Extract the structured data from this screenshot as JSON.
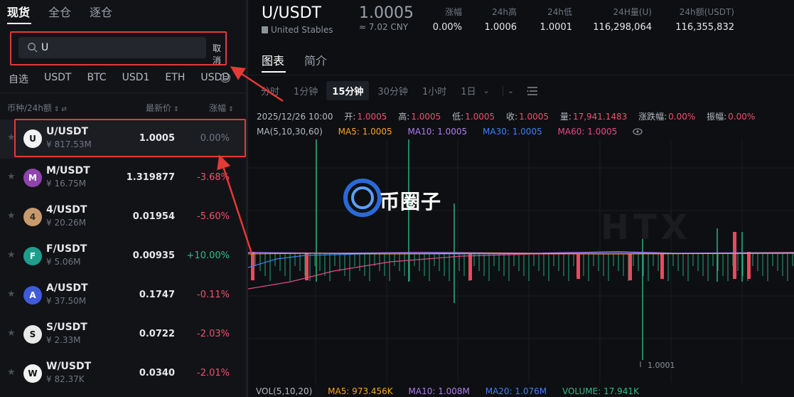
{
  "top_tabs": [
    {
      "label": "现货"
    },
    {
      "label": "全仓"
    },
    {
      "label": "逐仓"
    }
  ],
  "search": {
    "value": "U",
    "cancel_label": "取消"
  },
  "quote_tabs": [
    {
      "label": "自选"
    },
    {
      "label": "USDT"
    },
    {
      "label": "BTC"
    },
    {
      "label": "USD1"
    },
    {
      "label": "ETH"
    },
    {
      "label": "USDD"
    }
  ],
  "list_header": {
    "pair_col": "币种/24h额",
    "price_col": "最新价",
    "change_col": "涨幅"
  },
  "rows": [
    {
      "pair": "U/USDT",
      "vol": "¥ 817.53M",
      "price": "1.0005",
      "change": "0.00%",
      "dir": "neutral",
      "logo_bg": "#f2f2f2",
      "logo_fg": "#111111",
      "logo_char": "U"
    },
    {
      "pair": "M/USDT",
      "vol": "¥ 16.75M",
      "price": "1.319877",
      "change": "-3.68%",
      "dir": "down",
      "logo_bg": "#8e44ad",
      "logo_fg": "#ffffff",
      "logo_char": "M"
    },
    {
      "pair": "4/USDT",
      "vol": "¥ 20.26M",
      "price": "0.01954",
      "change": "-5.60%",
      "dir": "down",
      "logo_bg": "#c79a6e",
      "logo_fg": "#3a2a1e",
      "logo_char": "4"
    },
    {
      "pair": "F/USDT",
      "vol": "¥ 5.06M",
      "price": "0.00935",
      "change": "+10.00%",
      "dir": "up",
      "logo_bg": "#1e9c8c",
      "logo_fg": "#ffffff",
      "logo_char": "F"
    },
    {
      "pair": "A/USDT",
      "vol": "¥ 37.50M",
      "price": "0.1747",
      "change": "-0.11%",
      "dir": "down",
      "logo_bg": "#3f5bd9",
      "logo_fg": "#ffffff",
      "logo_char": "A"
    },
    {
      "pair": "S/USDT",
      "vol": "¥ 2.33M",
      "price": "0.0722",
      "change": "-2.03%",
      "dir": "down",
      "logo_bg": "#e8e8e8",
      "logo_fg": "#111111",
      "logo_char": "S"
    },
    {
      "pair": "W/USDT",
      "vol": "¥ 82.37K",
      "price": "0.0340",
      "change": "-2.01%",
      "dir": "down",
      "logo_bg": "#f2f2f2",
      "logo_fg": "#111111",
      "logo_char": "W"
    }
  ],
  "symbol": {
    "name": "U/USDT",
    "subtitle": "United Stables",
    "price": "1.0005",
    "cny": "≈ 7.02 CNY"
  },
  "stats": [
    {
      "label": "涨幅",
      "value": "0.00%"
    },
    {
      "label": "24h高",
      "value": "1.0006"
    },
    {
      "label": "24h低",
      "value": "1.0001"
    },
    {
      "label": "24H量(U)",
      "value": "116,298,064"
    },
    {
      "label": "24h额(USDT)",
      "value": "116,355,832"
    }
  ],
  "view_tabs": [
    {
      "label": "图表"
    },
    {
      "label": "简介"
    }
  ],
  "intervals": [
    {
      "label": "分时"
    },
    {
      "label": "1分钟"
    },
    {
      "label": "15分钟"
    },
    {
      "label": "30分钟"
    },
    {
      "label": "1小时"
    },
    {
      "label": "1日"
    }
  ],
  "ohlc": {
    "date": "2025/12/26 10:00",
    "open_k": "开:",
    "open": "1.0005",
    "high_k": "高:",
    "high": "1.0005",
    "low_k": "低:",
    "low": "1.0005",
    "close_k": "收:",
    "close": "1.0005",
    "vol_k": "量:",
    "vol": "17,941.1483",
    "chg_k": "涨跌幅:",
    "chg": "0.00%",
    "amp_k": "振幅:",
    "amp": "0.00%"
  },
  "ma": {
    "label": "MA(5,10,30,60)",
    "ma5": "MA5: 1.0005",
    "ma10": "MA10: 1.0005",
    "ma30": "MA30: 1.0005",
    "ma60": "MA60: 1.0005",
    "colors": {
      "ma5": "#f5a623",
      "ma10": "#b07cf0",
      "ma30": "#3b82f6",
      "ma60": "#e84a8a"
    }
  },
  "chart": {
    "low_marker": "1.0001"
  },
  "vol_ind": {
    "label": "VOL(5,10,20)",
    "ma5": "MA5: 973.456K",
    "ma10": "MA10: 1.008M",
    "ma20": "MA20: 1.076M",
    "volume": "VOLUME: 17.941K"
  },
  "watermark": {
    "text": "币圈子",
    "htx": "HTX"
  },
  "colors": {
    "accent_red": "#e53935",
    "up": "#2ebd85",
    "down": "#f0506e"
  }
}
